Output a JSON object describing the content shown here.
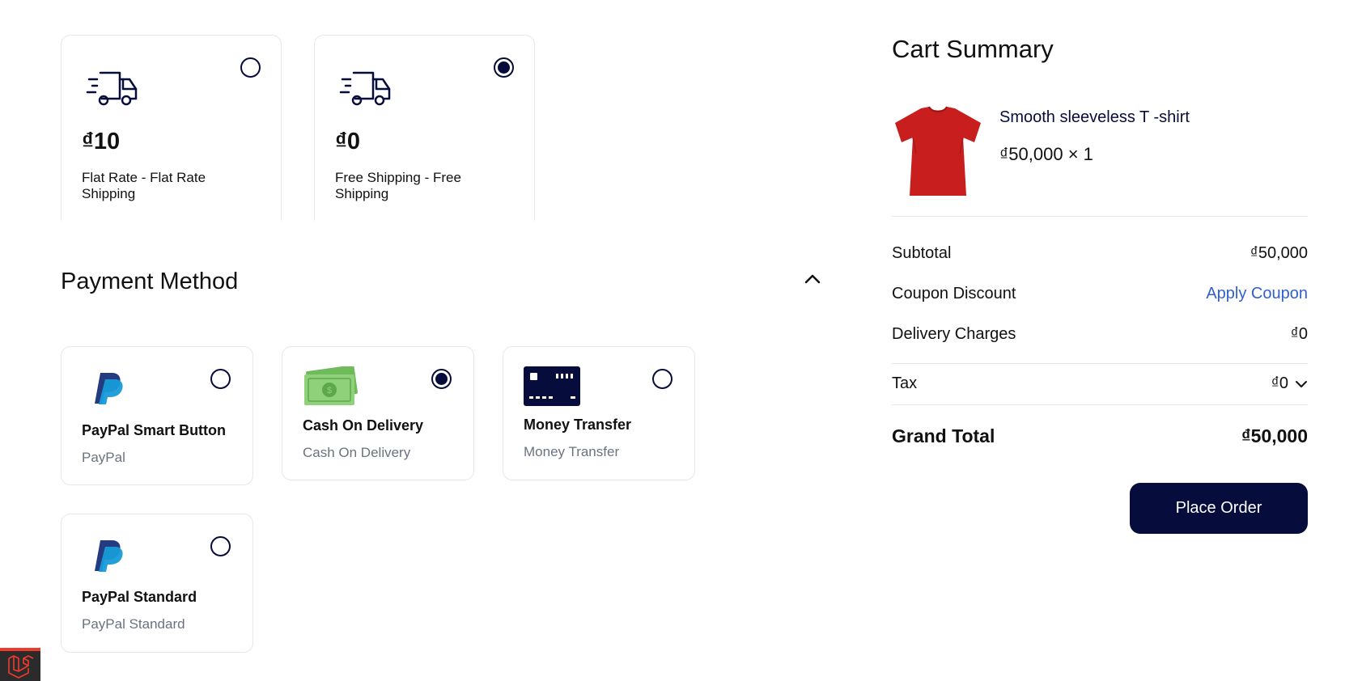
{
  "shipping_methods": [
    {
      "price": "₫10",
      "label": "Flat Rate - Flat Rate Shipping",
      "selected": false,
      "icon": "truck-icon"
    },
    {
      "price": "₫0",
      "label": "Free Shipping - Free Shipping",
      "selected": true,
      "icon": "truck-icon"
    }
  ],
  "payment": {
    "title": "Payment Method",
    "methods": [
      {
        "title": "PayPal Smart Button",
        "subtitle": "PayPal",
        "selected": false,
        "icon": "paypal-logo"
      },
      {
        "title": "Cash On Delivery",
        "subtitle": "Cash On Delivery",
        "selected": true,
        "icon": "cash-icon"
      },
      {
        "title": "Money Transfer",
        "subtitle": "Money Transfer",
        "selected": false,
        "icon": "card-icon"
      },
      {
        "title": "PayPal Standard",
        "subtitle": "PayPal Standard",
        "selected": false,
        "icon": "paypal-logo"
      }
    ]
  },
  "cart": {
    "title": "Cart Summary",
    "item": {
      "name": "Smooth sleeveless T -shirt",
      "price_qty": "₫50,000 × 1",
      "image": "red-tshirt"
    },
    "subtotal_label": "Subtotal",
    "subtotal_value": "₫50,000",
    "coupon_label": "Coupon Discount",
    "coupon_action": "Apply Coupon",
    "delivery_label": "Delivery Charges",
    "delivery_value": "₫0",
    "tax_label": "Tax",
    "tax_value": "₫0",
    "grand_total_label": "Grand Total",
    "grand_total_value": "₫50,000",
    "place_order": "Place Order"
  },
  "colors": {
    "primary": "#060c3b",
    "link": "#2f5fd0",
    "border": "#e5e7eb",
    "laravel_red": "#ef3b2d"
  }
}
